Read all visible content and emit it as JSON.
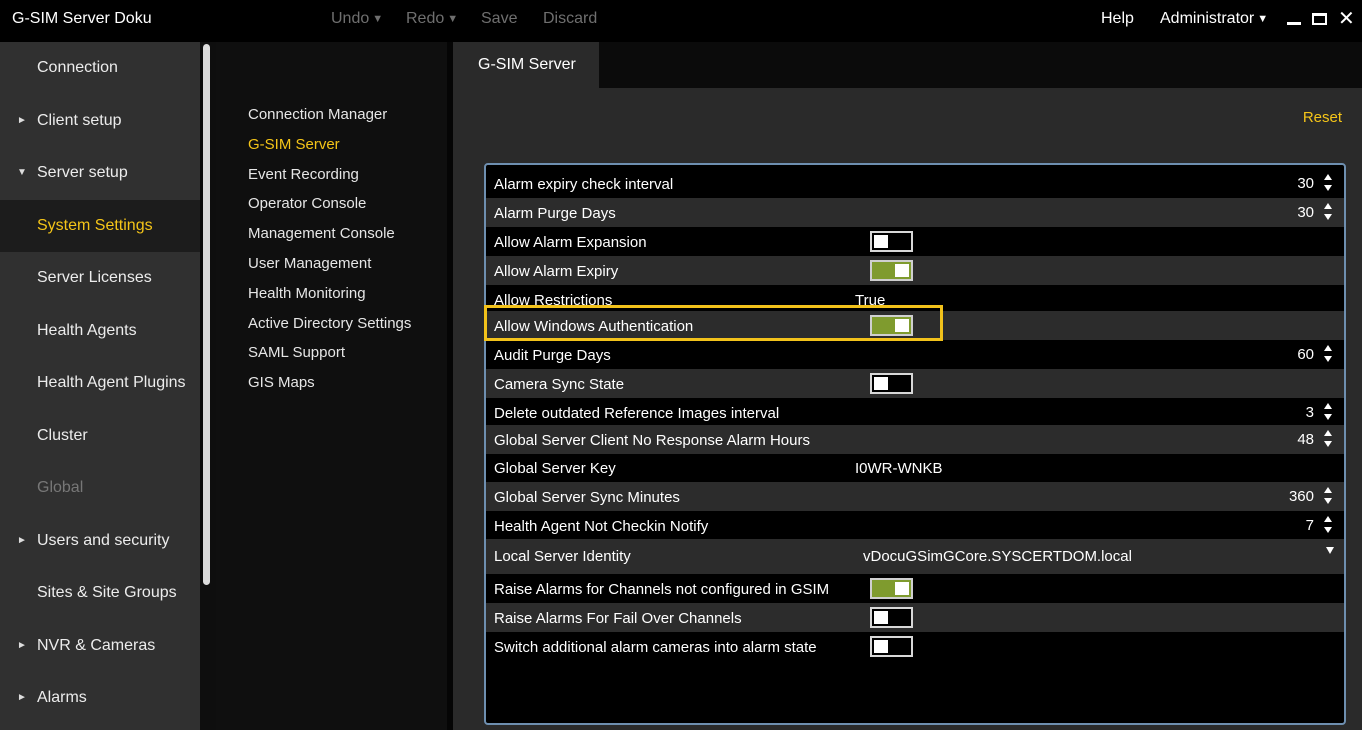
{
  "titlebar": {
    "app_title": "G-SIM Server Doku",
    "undo": "Undo",
    "redo": "Redo",
    "save": "Save",
    "discard": "Discard",
    "help": "Help",
    "user": "Administrator"
  },
  "leftnav": {
    "items": [
      {
        "label": "Connection",
        "expandable": false
      },
      {
        "label": "Client setup",
        "expandable": true,
        "expanded": false
      },
      {
        "label": "Server setup",
        "expandable": true,
        "expanded": true
      },
      {
        "label": "System Settings",
        "active": true
      },
      {
        "label": "Server Licenses"
      },
      {
        "label": "Health Agents"
      },
      {
        "label": "Health Agent Plugins"
      },
      {
        "label": "Cluster"
      },
      {
        "label": "Global",
        "disabled": true
      },
      {
        "label": "Users and security",
        "expandable": true,
        "expanded": false
      },
      {
        "label": "Sites & Site Groups"
      },
      {
        "label": "NVR & Cameras",
        "expandable": true,
        "expanded": false
      },
      {
        "label": "Alarms",
        "expandable": true,
        "expanded": false
      }
    ]
  },
  "subnav": {
    "items": [
      "Connection Manager",
      "G-SIM Server",
      "Event Recording",
      "Operator Console",
      "Management Console",
      "User Management",
      "Health Monitoring",
      "Active Directory Settings",
      "SAML Support",
      "GIS Maps"
    ],
    "active_index": 1
  },
  "main": {
    "tab": "G-SIM Server",
    "reset": "Reset",
    "settings": [
      {
        "label": "Alarm expiry check interval",
        "type": "number",
        "value": "30"
      },
      {
        "label": "Alarm Purge Days",
        "type": "number",
        "value": "30"
      },
      {
        "label": "Allow Alarm Expansion",
        "type": "toggle",
        "value": false
      },
      {
        "label": "Allow Alarm Expiry",
        "type": "toggle",
        "value": true
      },
      {
        "label": "Allow Restrictions",
        "type": "text",
        "value": "True"
      },
      {
        "label": "Allow Windows Authentication",
        "type": "toggle",
        "value": true
      },
      {
        "label": "Audit Purge Days",
        "type": "number",
        "value": "60"
      },
      {
        "label": "Camera Sync State",
        "type": "toggle",
        "value": false
      },
      {
        "label": "Delete outdated Reference Images interval",
        "type": "number",
        "value": "3"
      },
      {
        "label": "Global Server Client No Response Alarm Hours",
        "type": "number",
        "value": "48"
      },
      {
        "label": "Global Server Key",
        "type": "text",
        "value": "I0WR-WNKB"
      },
      {
        "label": "Global Server Sync Minutes",
        "type": "number",
        "value": "360"
      },
      {
        "label": "Health Agent Not Checkin Notify",
        "type": "number",
        "value": "7"
      },
      {
        "label": "Local Server Identity",
        "type": "dropdown",
        "value": "vDocuGSimGCore.SYSCERTDOM.local"
      },
      {
        "label": "Raise Alarms for Channels not configured in GSIM",
        "type": "toggle",
        "value": true
      },
      {
        "label": "Raise Alarms For Fail Over Channels",
        "type": "toggle",
        "value": false
      },
      {
        "label": "Switch additional alarm cameras into alarm state",
        "type": "toggle",
        "value": false
      }
    ]
  },
  "colors": {
    "accent": "#f5c518",
    "toggle_on": "#7f9b2e",
    "panel_border": "#6e8fb0",
    "highlight": "#f2c21b"
  }
}
